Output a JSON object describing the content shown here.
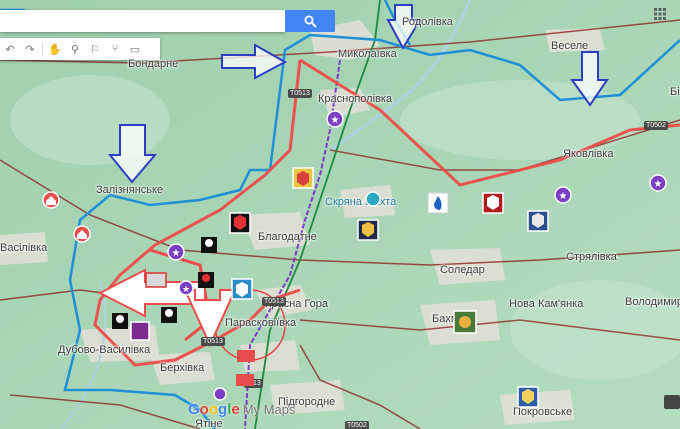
{
  "search": {
    "placeholder": ""
  },
  "places": [
    {
      "name": "Бондарне",
      "key": "bondarne"
    },
    {
      "name": "Миколаївка",
      "key": "mykolaivka"
    },
    {
      "name": "Веселе",
      "key": "vesele"
    },
    {
      "name": "Бі",
      "key": "bi"
    },
    {
      "name": "Краснополівка",
      "key": "krasnopolivka"
    },
    {
      "name": "Залізнянське",
      "key": "zaliznianske"
    },
    {
      "name": "Яковлівка",
      "key": "yakovlivka"
    },
    {
      "name": "Васілівка",
      "key": "vasilivka"
    },
    {
      "name": "Благодатне",
      "key": "blahodatne"
    },
    {
      "name": "Скряна шахта",
      "key": "shakhta"
    },
    {
      "name": "Стрялівка",
      "key": "striapivka"
    },
    {
      "name": "Соледар",
      "key": "soledar"
    },
    {
      "name": "Красна Гора",
      "key": "krasna-hora"
    },
    {
      "name": "Нова Кам'янка",
      "key": "nova-kamianka"
    },
    {
      "name": "Володимир",
      "key": "volodymyr"
    },
    {
      "name": "Парасковіївка",
      "key": "paraskoviivka"
    },
    {
      "name": "Бахмут",
      "key": "bakhmut"
    },
    {
      "name": "Дубово-Василівка",
      "key": "dubovo-vasylivka"
    },
    {
      "name": "Берхівка",
      "key": "berkhivka"
    },
    {
      "name": "Підгородне",
      "key": "pidhorodne"
    },
    {
      "name": "Покровське",
      "key": "pokrovske"
    },
    {
      "name": "Ятіне",
      "key": "yatine"
    },
    {
      "name": "Родолівка",
      "key": "rodolivka"
    }
  ],
  "roads": [
    "Т0513",
    "Т0513",
    "Т0513",
    "Р-13",
    "Т0502",
    "Т0502"
  ],
  "watermark": {
    "g1": "G",
    "g2": "o",
    "g3": "o",
    "g1b": "g",
    "g4": "l",
    "g2b": "e",
    "my_maps": "My Maps"
  },
  "icons": [
    "undo-icon",
    "redo-icon",
    "hand-icon",
    "marker-icon",
    "draw-line-icon",
    "route-icon",
    "ruler-icon"
  ],
  "colors": {
    "blue_line": "#1f8fd6",
    "red_line": "#ef4b4b",
    "arrow_outline": "#2c3fc4",
    "map_bg": "#a8d5b4"
  }
}
